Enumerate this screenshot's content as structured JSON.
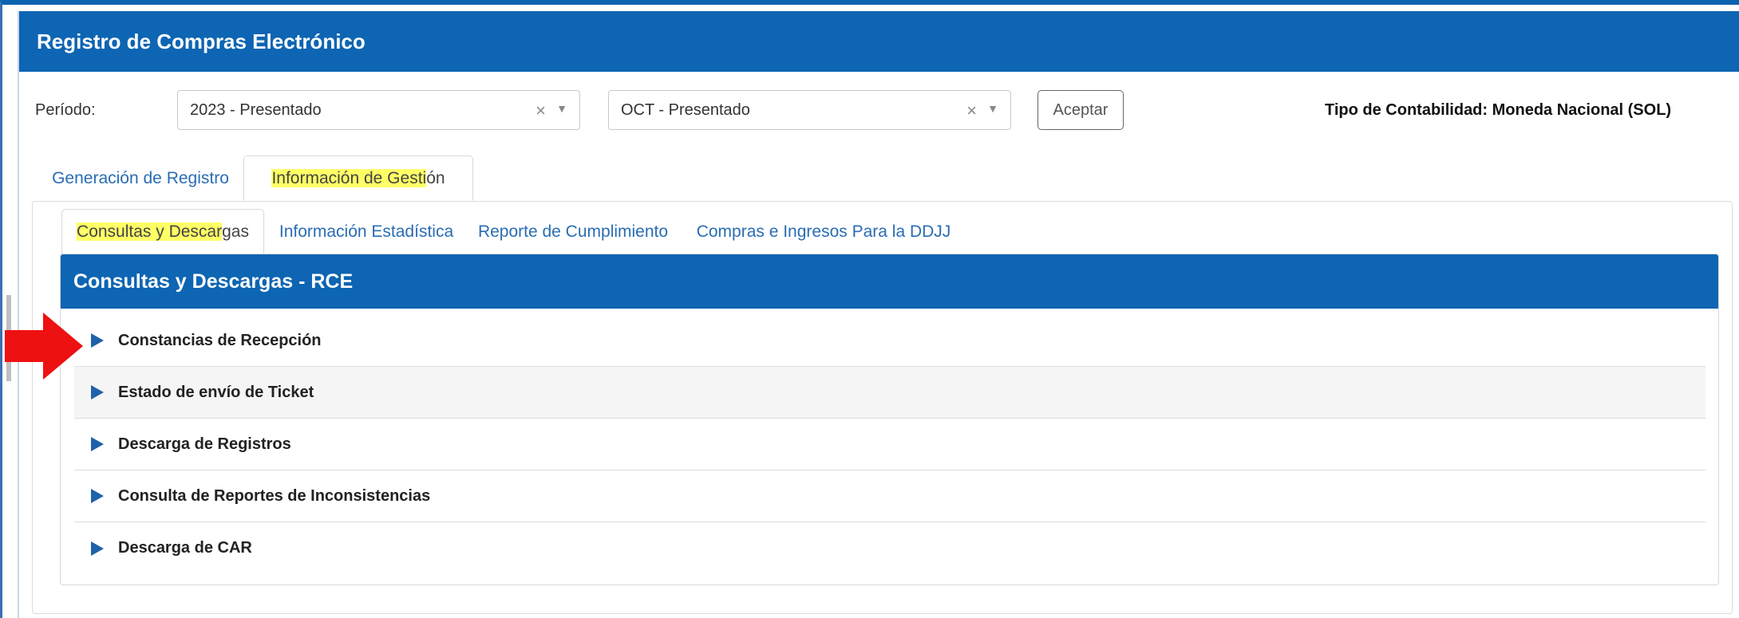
{
  "app": {
    "title": "Registro de Compras Electrónico"
  },
  "period": {
    "label": "Período:",
    "year_value": "2023 - Presentado",
    "month_value": "OCT - Presentado",
    "clear_glyph": "×",
    "dropdown_glyph": "▼",
    "accept_label": "Aceptar",
    "tipo_contabilidad": "Tipo de Contabilidad: Moneda Nacional (SOL)"
  },
  "main_tabs": [
    {
      "label": "Generación de Registro",
      "active": false
    },
    {
      "label": "Información de Gestión",
      "active": true,
      "highlight": "Información de Gesti",
      "rest": "ón"
    }
  ],
  "sub_tabs": [
    {
      "label": "Consultas y Descargas",
      "active": true,
      "highlight": "Consultas y Descar",
      "rest": "gas"
    },
    {
      "label": "Información Estadística",
      "active": false
    },
    {
      "label": "Reporte de Cumplimiento",
      "active": false
    },
    {
      "label": "Compras e Ingresos Para la DDJJ",
      "active": false
    }
  ],
  "card": {
    "title": "Consultas y Descargas - RCE",
    "items": [
      {
        "label": "Constancias de Recepción"
      },
      {
        "label": "Estado de envío de Ticket"
      },
      {
        "label": "Descarga de Registros"
      },
      {
        "label": "Consulta de Reportes de Inconsistencias"
      },
      {
        "label": "Descarga de CAR"
      }
    ]
  },
  "colors": {
    "brand": "#0d65b3",
    "link": "#2a6db3",
    "highlight": "#ffff66",
    "annotation_arrow": "#ee1111"
  },
  "icons": {
    "accordion": "triangle-right-icon",
    "annotation": "red-arrow-icon"
  }
}
